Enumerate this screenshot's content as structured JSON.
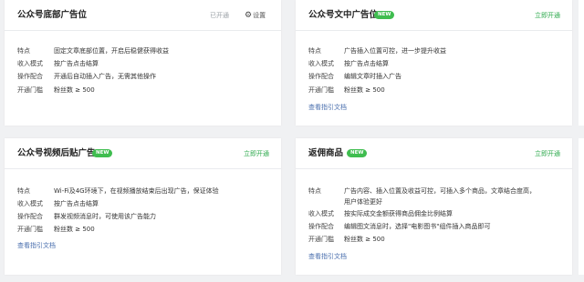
{
  "cards": {
    "bottom_ad": {
      "title": "公众号底部广告位",
      "status": "已开通",
      "settings_label": "设置",
      "rows": [
        {
          "label": "特点",
          "value": "固定文章底部位置，开启后稳健获得收益"
        },
        {
          "label": "收入模式",
          "value": "按广告点击结算"
        },
        {
          "label": "操作配合",
          "value": "开通后自动插入广告，无需其他操作"
        },
        {
          "label": "开通门槛",
          "value": "粉丝数 ≥ 500"
        }
      ]
    },
    "mid_article_ad": {
      "title": "公众号文中广告位",
      "badge": "NEW",
      "action": "立即开通",
      "rows": [
        {
          "label": "特点",
          "value": "广告插入位置可控，进一步提升收益"
        },
        {
          "label": "收入模式",
          "value": "按广告点击结算"
        },
        {
          "label": "操作配合",
          "value": "编辑文章时插入广告"
        },
        {
          "label": "开通门槛",
          "value": "粉丝数 ≥ 500"
        }
      ],
      "guide_link": "查看指引文档"
    },
    "video_post_ad": {
      "title": "公众号视频后贴广告",
      "badge": "NEW",
      "action": "立即开通",
      "rows": [
        {
          "label": "特点",
          "value": "Wi-Fi及4G环境下，在视频播放结束后出现广告，保证体验"
        },
        {
          "label": "收入模式",
          "value": "按广告点击结算"
        },
        {
          "label": "操作配合",
          "value": "群发视频消息时，可使用该广告能力"
        },
        {
          "label": "开通门槛",
          "value": "粉丝数 ≥ 500"
        }
      ],
      "guide_link": "查看指引文档"
    },
    "rebate_goods": {
      "title": "返佣商品",
      "badge": "NEW",
      "action": "立即开通",
      "rows": [
        {
          "label": "特点",
          "value": "广告内容、插入位置及收益可控，可插入多个商品，文章结合度高，",
          "value2": "用户体验更好"
        },
        {
          "label": "收入模式",
          "value": "按实际成交金额获得商品佣金比例结算"
        },
        {
          "label": "操作配合",
          "value": "编辑图文消息时，选择\"电影图书\"组件插入商品即可"
        },
        {
          "label": "开通门槛",
          "value": "粉丝数 ≥ 500"
        }
      ],
      "guide_link": "查看指引文档"
    }
  },
  "colors": {
    "page_bg": "#f0f1f3",
    "accent_green": "#2aa84a",
    "badge_green": "#3fbd4f",
    "link_blue": "#4a6fae"
  }
}
